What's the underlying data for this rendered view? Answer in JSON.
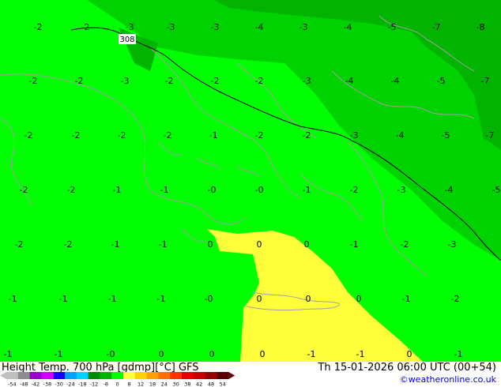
{
  "footer": {
    "title": "Height Temp. 700 hPa [gdmp][°C] GFS",
    "datetime": "Th 15-01-2026 06:00 UTC (00+54)",
    "credit": "©weatheronline.co.uk"
  },
  "scale": {
    "ticks": [
      "-54",
      "-48",
      "-42",
      "-38",
      "-30",
      "-24",
      "-18",
      "-12",
      "-8",
      "0",
      "8",
      "12",
      "18",
      "24",
      "30",
      "38",
      "42",
      "48",
      "54"
    ],
    "colors": [
      "#bfbfbf",
      "#8c8c8c",
      "#9a00cc",
      "#d200ff",
      "#1400ff",
      "#00a0ff",
      "#00d2ff",
      "#008c00",
      "#00b400",
      "#00ff00",
      "#ffff3c",
      "#ffd200",
      "#ffa000",
      "#ff6e00",
      "#ff3200",
      "#e60000",
      "#c80000",
      "#960000",
      "#5a0000"
    ]
  },
  "contour_label": "308",
  "temp_labels": [
    "-2",
    "-2",
    "-3",
    "-3",
    "-3",
    "-4",
    "-3",
    "-4",
    "-5",
    "-7",
    "-8",
    "-2",
    "-2",
    "-3",
    "-2",
    "-2",
    "-2",
    "-3",
    "-4",
    "-4",
    "-5",
    "-7",
    "-2",
    "-2",
    "-2",
    "-2",
    "-1",
    "-2",
    "-2",
    "-3",
    "-4",
    "-5",
    "-7",
    "-2",
    "-2",
    "-1",
    "-1",
    "-0",
    "-0",
    "-1",
    "-2",
    "-3",
    "-4",
    "-5",
    "-2",
    "-2",
    "-1",
    "-1",
    "0",
    "0",
    "0",
    "-1",
    "-2",
    "-3",
    "-1",
    "-1",
    "-1",
    "-1",
    "-0",
    "0",
    "0",
    "0",
    "-1",
    "-2",
    "-1",
    "-1",
    "-0",
    "0",
    "0",
    "0",
    "-1",
    "-1",
    "0",
    "-1"
  ],
  "colors": {
    "bright_green": "#00ff00",
    "mid_green": "#00d200",
    "dark_green": "#00b400",
    "yellow": "#ffff3c",
    "contour_line": "#000000",
    "coast_line": "#a0a0a0"
  }
}
